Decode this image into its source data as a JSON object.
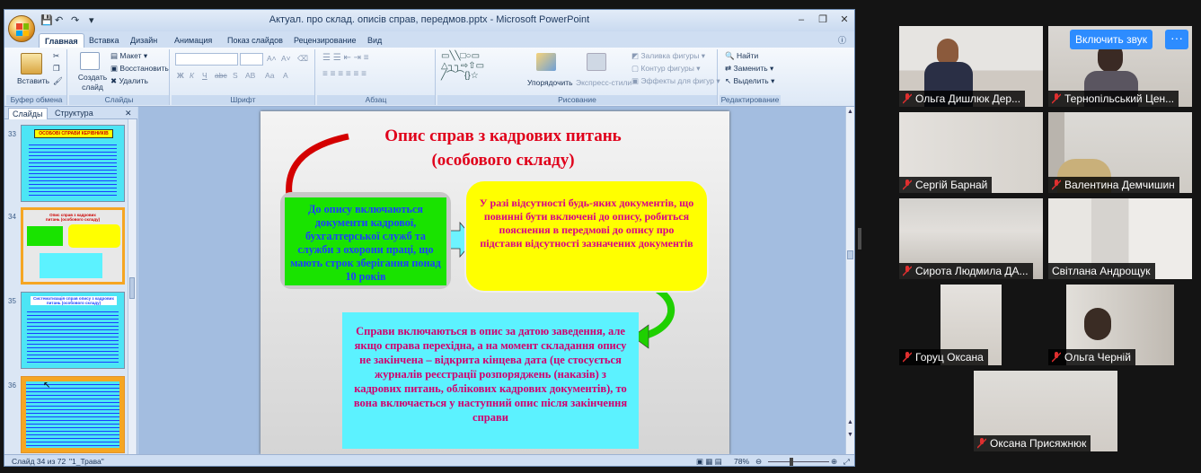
{
  "window": {
    "title": "Актуал. про склад. описів справ, передмов.pptx - Microsoft PowerPoint",
    "qat_icons": [
      "save-icon",
      "undo-icon",
      "redo-icon",
      "customize-icon"
    ]
  },
  "ribbon_tabs": [
    "Главная",
    "Вставка",
    "Дизайн",
    "Анимация",
    "Показ слайдов",
    "Рецензирование",
    "Вид"
  ],
  "ribbon": {
    "clipboard": {
      "paste": "Вставить",
      "label": "Буфер обмена"
    },
    "slides": {
      "create": "Создать слайд",
      "layout": "Макет",
      "reset": "Восстановить",
      "delete": "Удалить",
      "label": "Слайды"
    },
    "font": {
      "font_name": "",
      "font_size": "",
      "label": "Шрифт",
      "buttons": [
        "Ж",
        "К",
        "Ч",
        "abc",
        "S",
        "АВ",
        "Аа",
        "А"
      ]
    },
    "paragraph": {
      "label": "Абзац"
    },
    "drawing": {
      "arrange": "Упорядочить",
      "quick_styles": "Экспресс-стили",
      "fill": "Заливка фигуры",
      "outline": "Контур фигуры",
      "effects": "Эффекты для фигур",
      "label": "Рисование"
    },
    "editing": {
      "find": "Найти",
      "replace": "Заменить",
      "select": "Выделить",
      "label": "Редактирование"
    }
  },
  "slides_pane": {
    "tabs": [
      "Слайды",
      "Структура"
    ],
    "thumbnails": [
      {
        "number": "33",
        "title": "ОСОБОВІ СПРАВИ КЕРІВНИКІВ"
      },
      {
        "number": "34",
        "title": "Опис справ з кадрових питань (особового складу)"
      },
      {
        "number": "35",
        "title": "Систематизація справ опису з кадрових питань (особового складу)"
      },
      {
        "number": "36",
        "title": ""
      }
    ]
  },
  "slide": {
    "title_line1": "Опис справ з кадрових питань",
    "title_line2": "(особового складу)",
    "box_green": "До опису включаються документи кадрової, бухгалтерської служб та служби з охорони праці, що мають строк зберігання понад 10 років",
    "box_yellow": "У разі відсутності будь-яких документів, що повинні бути включені до опису, робиться пояснення в передмові до опису про підстави відсутності зазначених документів",
    "box_cyan": "Справи включаються в опис за датою заведення,  але якщо справа перехідна, а на момент складання опису не закінчена – відкрита кінцева дата (це стосується журналів реєстрації розпоряджень (наказів) з кадрових питань, облікових кадрових документів), то вона включається  у наступний опис після закінчення справи"
  },
  "statusbar": {
    "slide_info": "Слайд 34 из 72",
    "theme": "\"1_Трава\"",
    "zoom": "78%"
  },
  "zoom_panel": {
    "unmute_label": "Включить звук",
    "more_label": "···",
    "participants": [
      "Ольга Дишлюк Дер...",
      "Тернопільський Цен...",
      "Сергій Барнай",
      "Валентина Демчишин",
      "Сирота Людмила ДА...",
      "Світлана Андрощук",
      "Горуц Оксана",
      "Ольга Черній",
      "Оксана Присяжнюк"
    ]
  },
  "colors": {
    "title_red": "#e0001b",
    "green_box": "#19e300",
    "yellow_box": "#ffff00",
    "cyan_box": "#5cf2ff",
    "text_blue": "#1b3fff",
    "text_magenta": "#d1006f",
    "muted_mic": "#e02f2f"
  }
}
